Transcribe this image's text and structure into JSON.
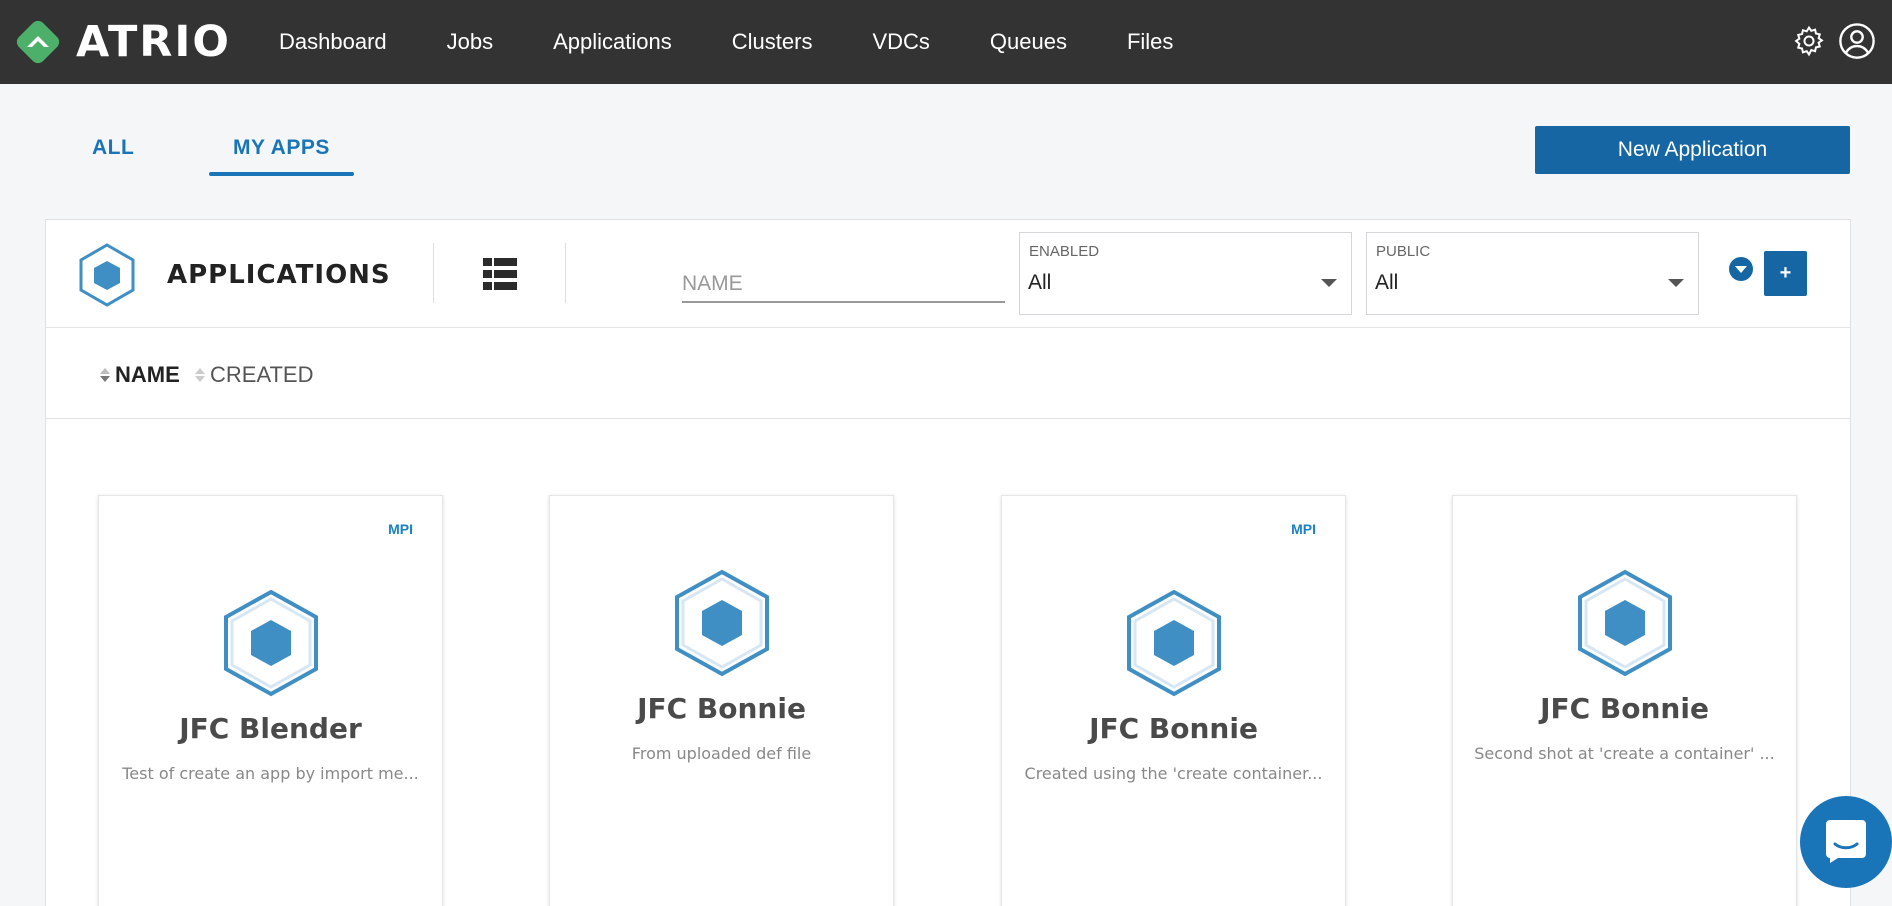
{
  "brand": {
    "name": "ATRIO"
  },
  "nav": {
    "items": [
      "Dashboard",
      "Jobs",
      "Applications",
      "Clusters",
      "VDCs",
      "Queues",
      "Files"
    ]
  },
  "tabs": {
    "all": "ALL",
    "my_apps": "MY APPS",
    "active": "MY APPS"
  },
  "actions": {
    "new_application": "New Application",
    "add": "+"
  },
  "panel": {
    "title": "APPLICATIONS",
    "name_placeholder": "NAME",
    "enabled": {
      "label": "ENABLED",
      "value": "All"
    },
    "public": {
      "label": "PUBLIC",
      "value": "All"
    },
    "sort": {
      "name": "NAME",
      "created": "CREATED",
      "active": "NAME"
    }
  },
  "cards": [
    {
      "title": "JFC Blender",
      "description": "Test of create an app by import me...",
      "badge": "MPI"
    },
    {
      "title": "JFC Bonnie",
      "description": "From uploaded def file",
      "badge": ""
    },
    {
      "title": "JFC Bonnie",
      "description": "Created using the 'create container...",
      "badge": "MPI"
    },
    {
      "title": "JFC Bonnie",
      "description": "Second shot at 'create a container' ...",
      "badge": ""
    }
  ],
  "colors": {
    "topbar": "#333333",
    "accent": "#1566a3",
    "logo_green": "#4caf6a",
    "icon_blue": "#3f8fc4"
  }
}
